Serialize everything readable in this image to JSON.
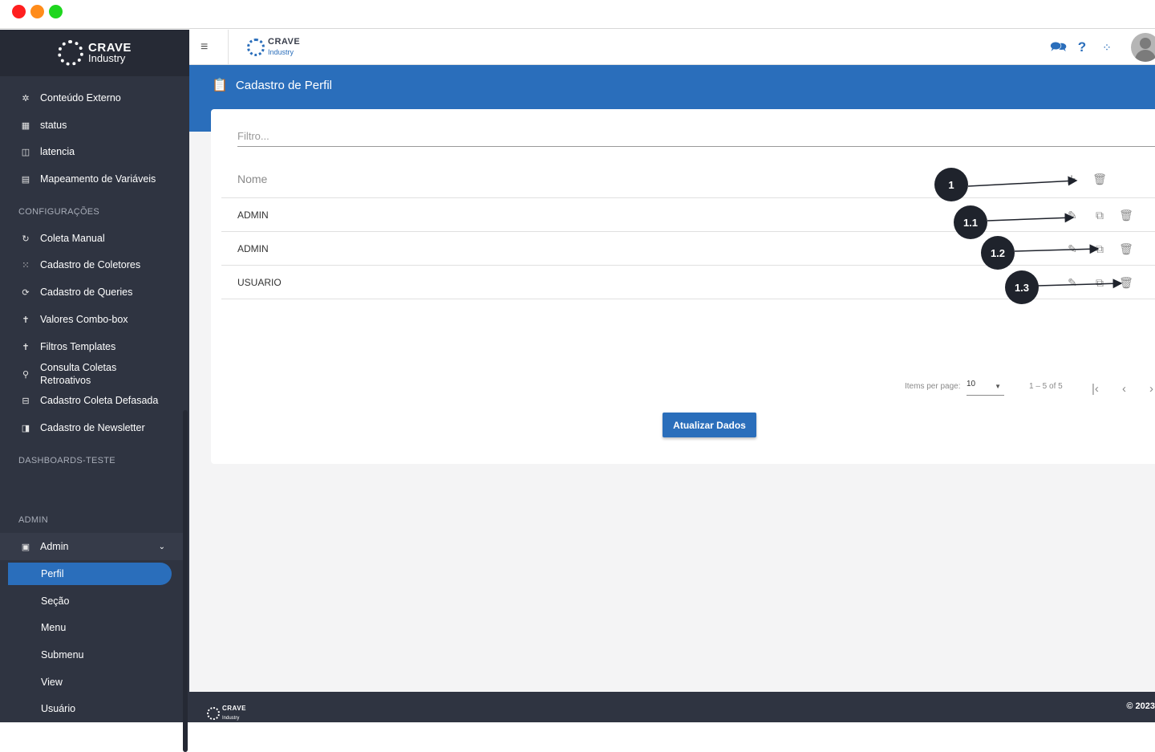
{
  "brand": {
    "name": "CRAVE",
    "sub": "Industry"
  },
  "sidebar": {
    "items_top": [
      {
        "label": "Conteúdo Externo",
        "icon": "external-content-icon"
      },
      {
        "label": "status",
        "icon": "status-icon"
      },
      {
        "label": "latencia",
        "icon": "latency-icon"
      },
      {
        "label": "Mapeamento de Variáveis",
        "icon": "variables-icon"
      }
    ],
    "section_config": "CONFIGURAÇÕES",
    "items_config": [
      {
        "label": "Coleta Manual",
        "icon": "refresh-icon"
      },
      {
        "label": "Cadastro de Coletores",
        "icon": "grid-icon"
      },
      {
        "label": "Cadastro de Queries",
        "icon": "sync-icon"
      },
      {
        "label": "Valores Combo-box",
        "icon": "pin-icon"
      },
      {
        "label": "Filtros Templates",
        "icon": "pin-icon"
      },
      {
        "label": "Consulta Coletas Retroativos",
        "icon": "search-icon"
      },
      {
        "label": "Cadastro Coleta Defasada",
        "icon": "form-icon"
      },
      {
        "label": "Cadastro de Newsletter",
        "icon": "newsletter-icon"
      }
    ],
    "section_dash": "DASHBOARDS-TESTE",
    "section_admin": "ADMIN",
    "admin_label": "Admin",
    "admin_sub": [
      "Perfil",
      "Seção",
      "Menu",
      "Submenu",
      "View",
      "Usuário"
    ]
  },
  "page": {
    "title": "Cadastro de Perfil",
    "filter_placeholder": "Filtro...",
    "column_name": "Nome",
    "rows": [
      "ADMIN",
      "ADMIN",
      "USUARIO"
    ],
    "items_per_page_label": "Items per page:",
    "items_per_page_value": "10",
    "range": "1 – 5 of 5",
    "update_button": "Atualizar Dados"
  },
  "callouts": [
    "1",
    "1.1",
    "1.2",
    "1.3"
  ],
  "footer": {
    "copyright": "© 2023"
  },
  "colors": {
    "primary": "#2a6ebb",
    "sidebar": "#2f3441",
    "callout": "#1f232c"
  }
}
